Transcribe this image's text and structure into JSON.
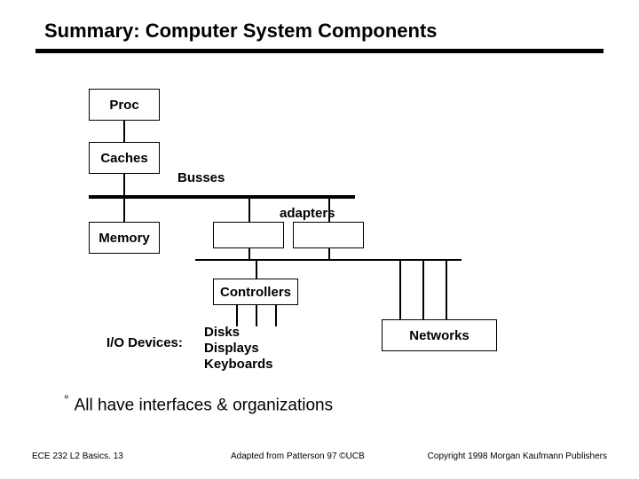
{
  "title": "Summary: Computer System Components",
  "boxes": {
    "proc": "Proc",
    "caches": "Caches",
    "memory": "Memory",
    "controllers": "Controllers",
    "networks": "Networks"
  },
  "labels": {
    "busses": "Busses",
    "adapters": "adapters",
    "io_devices": "I/O Devices:",
    "disks": "Disks",
    "displays": "Displays",
    "keyboards": "Keyboards"
  },
  "bullet": "All have interfaces & organizations",
  "footer": {
    "left": "ECE 232  L2 Basics. 13",
    "mid": "Adapted from Patterson 97 ©UCB",
    "right": "Copyright 1998 Morgan Kaufmann Publishers"
  }
}
